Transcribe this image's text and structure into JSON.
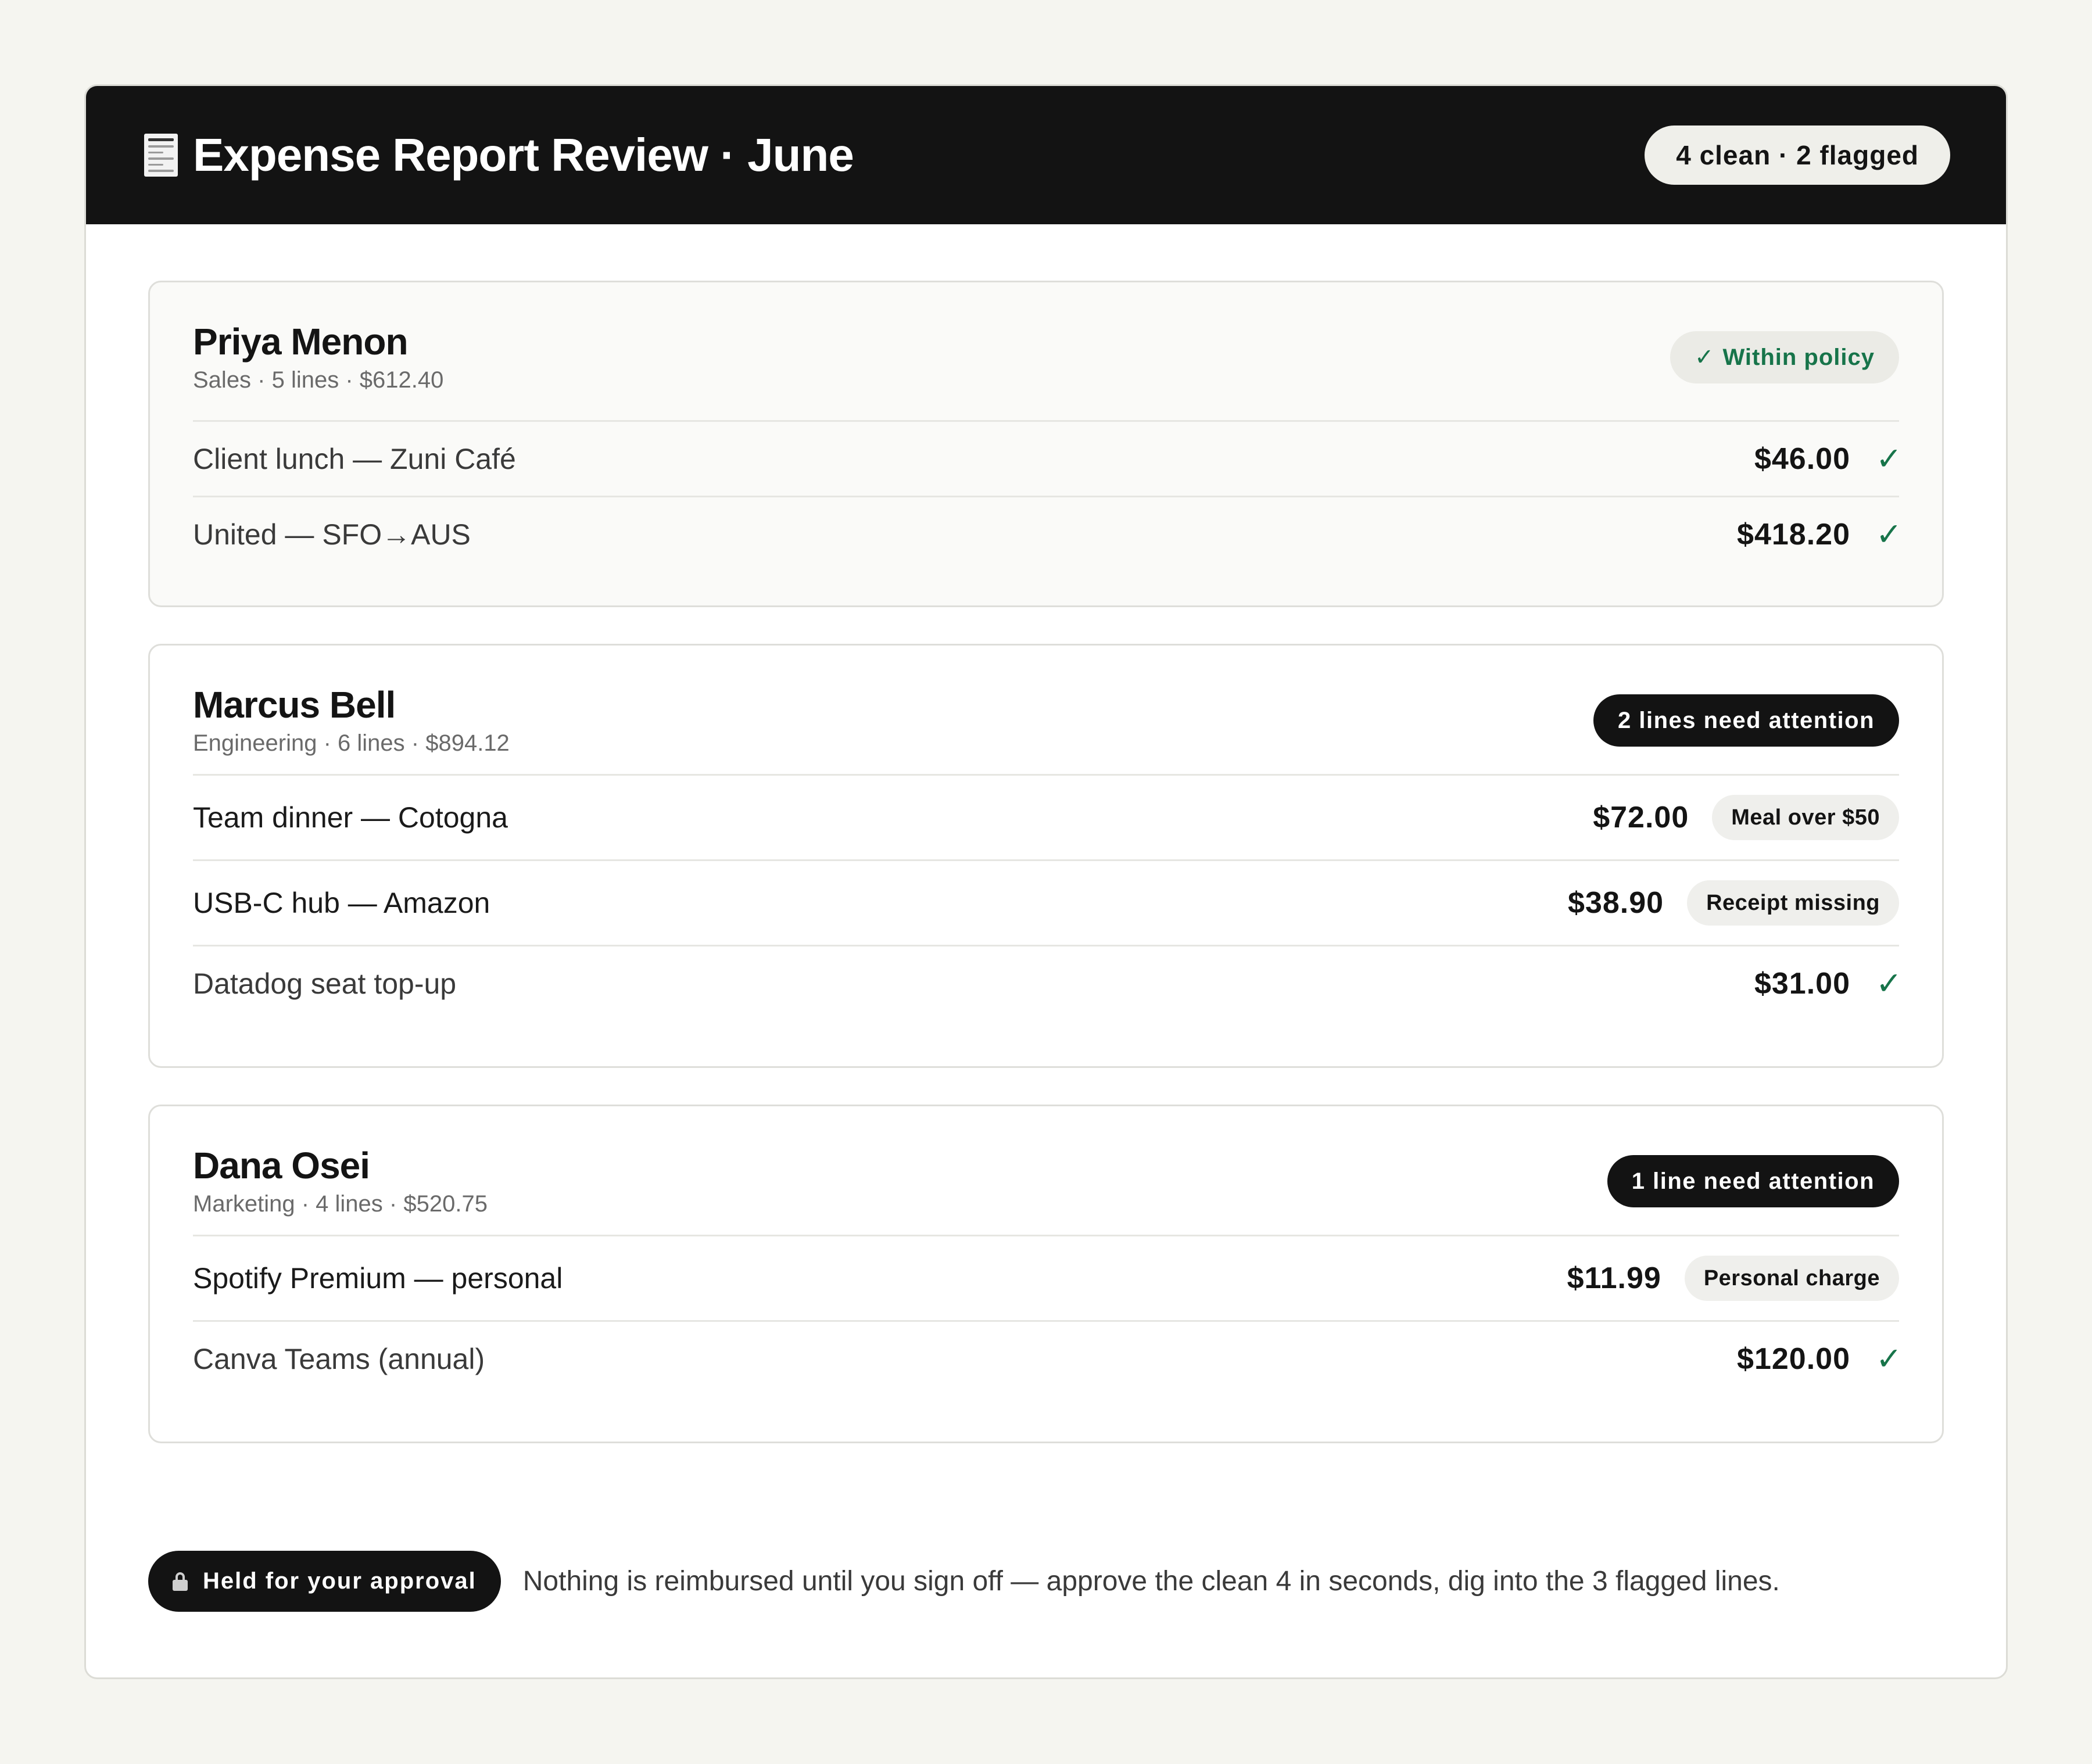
{
  "header": {
    "title": "Expense Report Review · June",
    "summary": "4 clean · 2 flagged"
  },
  "reports": [
    {
      "name": "Priya Menon",
      "meta": "Sales · 5 lines · $612.40",
      "status": "Within policy",
      "status_check": "✓",
      "lines": [
        {
          "desc": "Client lunch — Zuni Café",
          "amount": "$46.00",
          "check": "✓"
        },
        {
          "desc": "United — SFO→AUS",
          "amount": "$418.20",
          "check": "✓"
        }
      ]
    },
    {
      "name": "Marcus Bell",
      "meta": "Engineering · 6 lines · $894.12",
      "status": "2 lines need attention",
      "lines": [
        {
          "desc": "Team dinner — Cotogna",
          "amount": "$72.00",
          "flag": "Meal over $50"
        },
        {
          "desc": "USB-C hub — Amazon",
          "amount": "$38.90",
          "flag": "Receipt missing"
        },
        {
          "desc": "Datadog seat top-up",
          "amount": "$31.00",
          "check": "✓"
        }
      ]
    },
    {
      "name": "Dana Osei",
      "meta": "Marketing · 4 lines · $520.75",
      "status": "1 line need attention",
      "lines": [
        {
          "desc": "Spotify Premium — personal",
          "amount": "$11.99",
          "flag": "Personal charge"
        },
        {
          "desc": "Canva Teams (annual)",
          "amount": "$120.00",
          "check": "✓"
        }
      ]
    }
  ],
  "footer": {
    "approval_label": "Held for your approval",
    "note": "Nothing is reimbursed until you sign off — approve the clean 4 in seconds, dig into the 3 flagged lines."
  },
  "colors": {
    "accent_dark": "#131313",
    "ok_green": "#17744a",
    "background": "#f5f5f0"
  },
  "icons": {
    "header": "receipt-icon",
    "footer": "lock-icon",
    "ok": "check-icon"
  }
}
